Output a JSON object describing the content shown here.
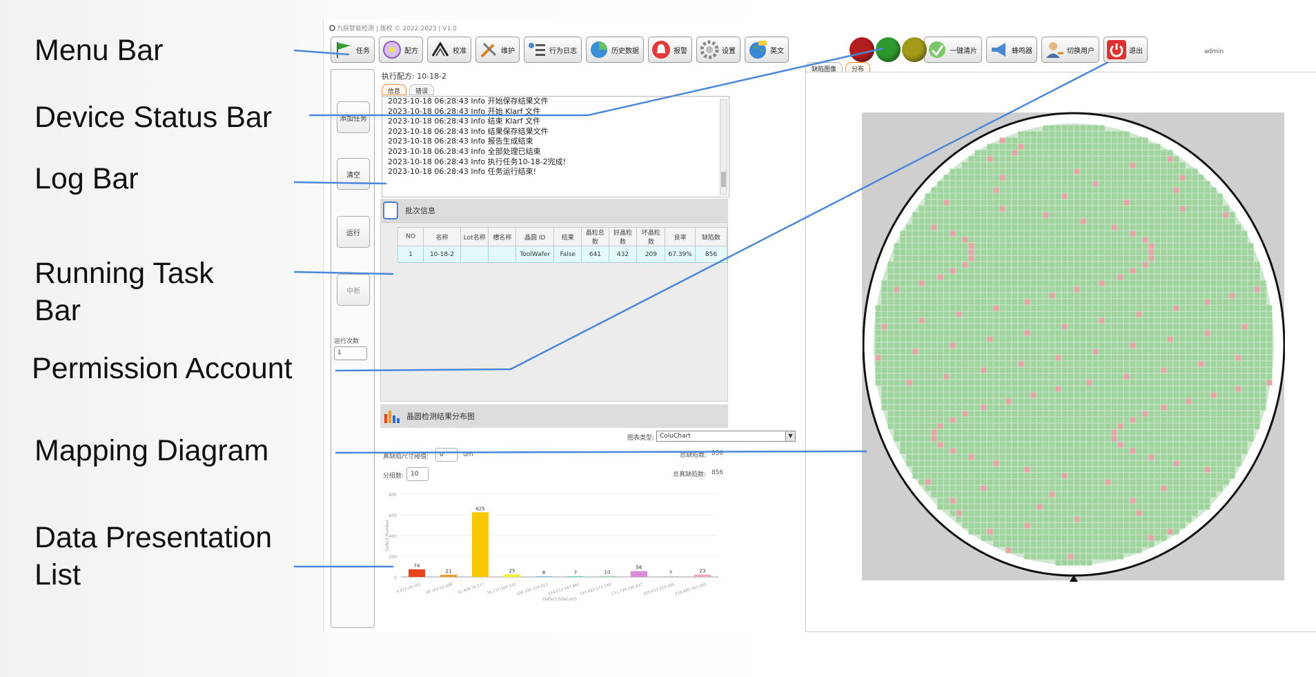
{
  "callouts": {
    "menu_bar": "Menu Bar",
    "device_status_bar": "Device Status Bar",
    "log_bar": "Log Bar",
    "running_task_bar": "Running Task\nBar",
    "permission_account": "Permission Account",
    "mapping_diagram": "Mapping Diagram",
    "data_presentation_list": "Data Presentation\nList"
  },
  "app": {
    "title": "九辰智能检测 | 版权 © 2022-2023 | V1.0",
    "user": "admin",
    "menu": [
      {
        "label": "任务",
        "icon": "task-flag-icon"
      },
      {
        "label": "配方",
        "icon": "recipe-disc-icon"
      },
      {
        "label": "校准",
        "icon": "calibration-icon"
      },
      {
        "label": "维护",
        "icon": "maintenance-tools-icon"
      },
      {
        "label": "行为日志",
        "icon": "behavior-log-icon"
      },
      {
        "label": "历史数据",
        "icon": "history-data-icon"
      },
      {
        "label": "报警",
        "icon": "alarm-bell-icon"
      },
      {
        "label": "设置",
        "icon": "settings-gear-icon"
      },
      {
        "label": "英文",
        "icon": "language-globe-icon"
      },
      {
        "label": "一键清片",
        "icon": "clear-wafer-icon"
      },
      {
        "label": "蜂鸣器",
        "icon": "buzzer-horn-icon"
      },
      {
        "label": "切换用户",
        "icon": "switch-user-icon"
      },
      {
        "label": "退出",
        "icon": "exit-power-icon"
      }
    ],
    "status_lights": [
      {
        "name": "red",
        "color": "#b21e1e"
      },
      {
        "name": "green",
        "color": "#2e9a2e"
      },
      {
        "name": "yellow",
        "color": "#a39a1a"
      }
    ],
    "sidebar": {
      "buttons": [
        "添加任务",
        "清空",
        "运行",
        "中断"
      ],
      "run_count_label": "运行次数",
      "run_count_value": "1"
    },
    "recipe_label": "执行配方: 10-18-2",
    "log_tabs": [
      "信息",
      "错误"
    ],
    "log_lines": [
      "2023-10-18 06:28:43  Info  开始保存结果文件",
      "2023-10-18 06:28:43  Info  开始 Klarf 文件",
      "2023-10-18 06:28:43  Info  结束 Klarf 文件",
      "2023-10-18 06:28:43  Info  结果保存结果文件",
      "2023-10-18 06:28:43  Info  报告生成结束",
      "2023-10-18 06:28:43  Info  全部处理已结束",
      "2023-10-18 06:28:43  Info  执行任务10-18-2完成!",
      "2023-10-18 06:28:43  Info  任务运行结束!"
    ],
    "batch": {
      "title": "批次信息",
      "columns": [
        "NO",
        "名称",
        "Lot名称",
        "槽名称",
        "晶圆 ID",
        "结果",
        "晶粒总数",
        "好晶粒数",
        "坏晶粒数",
        "良率",
        "缺陷数"
      ],
      "rows": [
        [
          "1",
          "10-18-2",
          "",
          "",
          "ToolWafer",
          "False",
          "641",
          "432",
          "209",
          "67.39%",
          "856"
        ]
      ]
    },
    "chart_panel": {
      "title": "晶圆检测结果分布图",
      "chart_type_label": "图表类型:",
      "chart_type_value": "ColuChart",
      "threshold_label": "真缺陷尺寸阈值:",
      "threshold_value": "0",
      "threshold_unit": "um",
      "groups_label": "分组数:",
      "groups_value": "10",
      "total_defects_label": "总缺陷数:",
      "total_defects_value": "856",
      "total_true_defects_label": "总真缺陷数:",
      "total_true_defects_value": "856"
    },
    "map_tabs": [
      "缺陷图像",
      "分布"
    ]
  },
  "chart_data": {
    "type": "bar",
    "categories": [
      "4.473-28.343",
      "28.343-52.409",
      "52.409-76.277",
      "76.277-100.145",
      "100.145-124.013",
      "124.013-147.881",
      "147.881-171.749",
      "171.749-195.617",
      "195.617-219.485",
      "219.485-243.353"
    ],
    "values": [
      74,
      21,
      625,
      25,
      8,
      7,
      10,
      56,
      7,
      23
    ],
    "colors": [
      "#e8431c",
      "#f09a2a",
      "#f7c800",
      "#f2ee3a",
      "#7cc4f0",
      "#60d6c8",
      "#9be3b0",
      "#d98ad9",
      "#c0c0c0",
      "#f4a6b8"
    ],
    "xlabel": "Defect Size[um]",
    "ylabel": "Defect Number",
    "ylim": [
      0,
      800
    ],
    "yticks": [
      0,
      200,
      400,
      600,
      800
    ],
    "grid": true
  },
  "wafer_map": {
    "good_die_color": "#9fd49f",
    "bad_die_color": "#e3a5a5",
    "edge_color": "#111111"
  }
}
